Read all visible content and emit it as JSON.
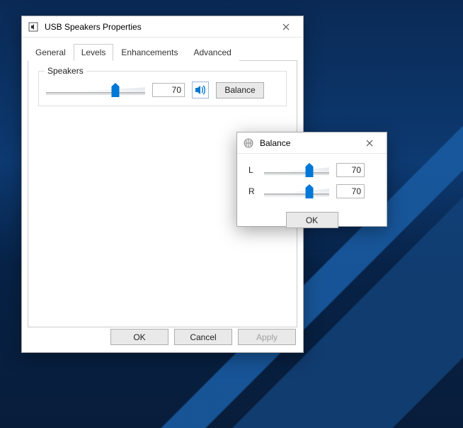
{
  "mainWindow": {
    "title": "USB Speakers Properties",
    "tabs": {
      "general": "General",
      "levels": "Levels",
      "enhancements": "Enhancements",
      "advanced": "Advanced"
    },
    "activeTab": "levels",
    "speakersGroup": {
      "legend": "Speakers",
      "value": "70",
      "sliderPercent": 70,
      "balanceButton": "Balance"
    },
    "buttons": {
      "ok": "OK",
      "cancel": "Cancel",
      "apply": "Apply"
    }
  },
  "balanceWindow": {
    "title": "Balance",
    "channels": {
      "left": {
        "label": "L",
        "value": "70",
        "sliderPercent": 70
      },
      "right": {
        "label": "R",
        "value": "70",
        "sliderPercent": 70
      }
    },
    "okButton": "OK"
  },
  "icons": {
    "close": "close-icon",
    "speakerMain": "speaker-app-icon",
    "speakerSmall": "speaker-mute-icon",
    "globe": "globe-icon"
  },
  "colors": {
    "accent": "#0078d7",
    "windowBorder": "#aaaaaa",
    "buttonFace": "#e9e9e9"
  }
}
